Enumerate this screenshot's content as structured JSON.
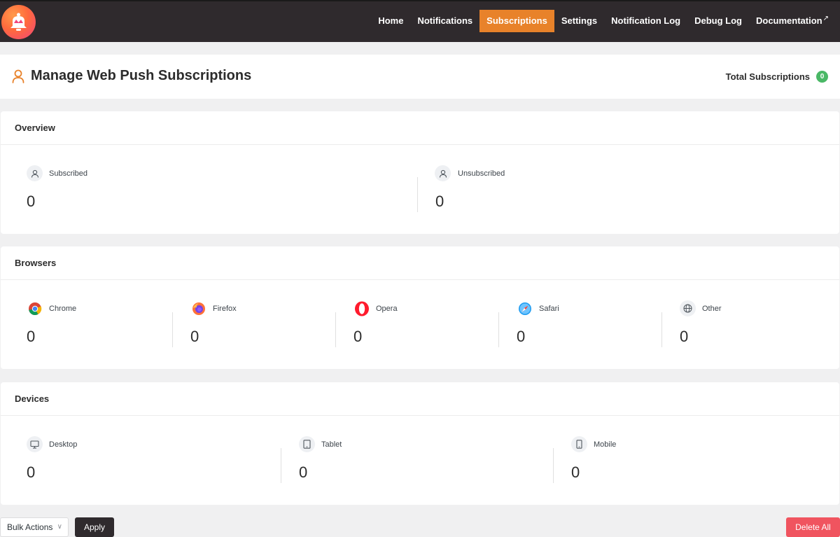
{
  "nav": {
    "items": [
      {
        "label": "Home"
      },
      {
        "label": "Notifications"
      },
      {
        "label": "Subscriptions",
        "active": true
      },
      {
        "label": "Settings"
      },
      {
        "label": "Notification Log"
      },
      {
        "label": "Debug Log"
      },
      {
        "label": "Documentation",
        "external": true
      }
    ],
    "external_glyph": "↗",
    "active_color": "#e8822a"
  },
  "header": {
    "title": "Manage Web Push Subscriptions",
    "total_label": "Total Subscriptions",
    "total_count": "0",
    "icon": "user-icon"
  },
  "overview": {
    "title": "Overview",
    "stats": [
      {
        "label": "Subscribed",
        "value": "0",
        "icon": "user-icon"
      },
      {
        "label": "Unsubscribed",
        "value": "0",
        "icon": "user-icon"
      }
    ]
  },
  "browsers": {
    "title": "Browsers",
    "stats": [
      {
        "label": "Chrome",
        "value": "0",
        "icon": "chrome-icon"
      },
      {
        "label": "Firefox",
        "value": "0",
        "icon": "firefox-icon"
      },
      {
        "label": "Opera",
        "value": "0",
        "icon": "opera-icon"
      },
      {
        "label": "Safari",
        "value": "0",
        "icon": "safari-icon"
      },
      {
        "label": "Other",
        "value": "0",
        "icon": "globe-icon"
      }
    ]
  },
  "devices": {
    "title": "Devices",
    "stats": [
      {
        "label": "Desktop",
        "value": "0",
        "icon": "desktop-icon"
      },
      {
        "label": "Tablet",
        "value": "0",
        "icon": "tablet-icon"
      },
      {
        "label": "Mobile",
        "value": "0",
        "icon": "mobile-icon"
      }
    ]
  },
  "actions": {
    "bulk_actions": "Bulk Actions",
    "apply": "Apply",
    "delete_all": "Delete All"
  },
  "colors": {
    "brand_orange": "#e8822a",
    "badge_green": "#4ab866",
    "danger_red": "#f0545f",
    "topbar": "#2f2a2d"
  }
}
